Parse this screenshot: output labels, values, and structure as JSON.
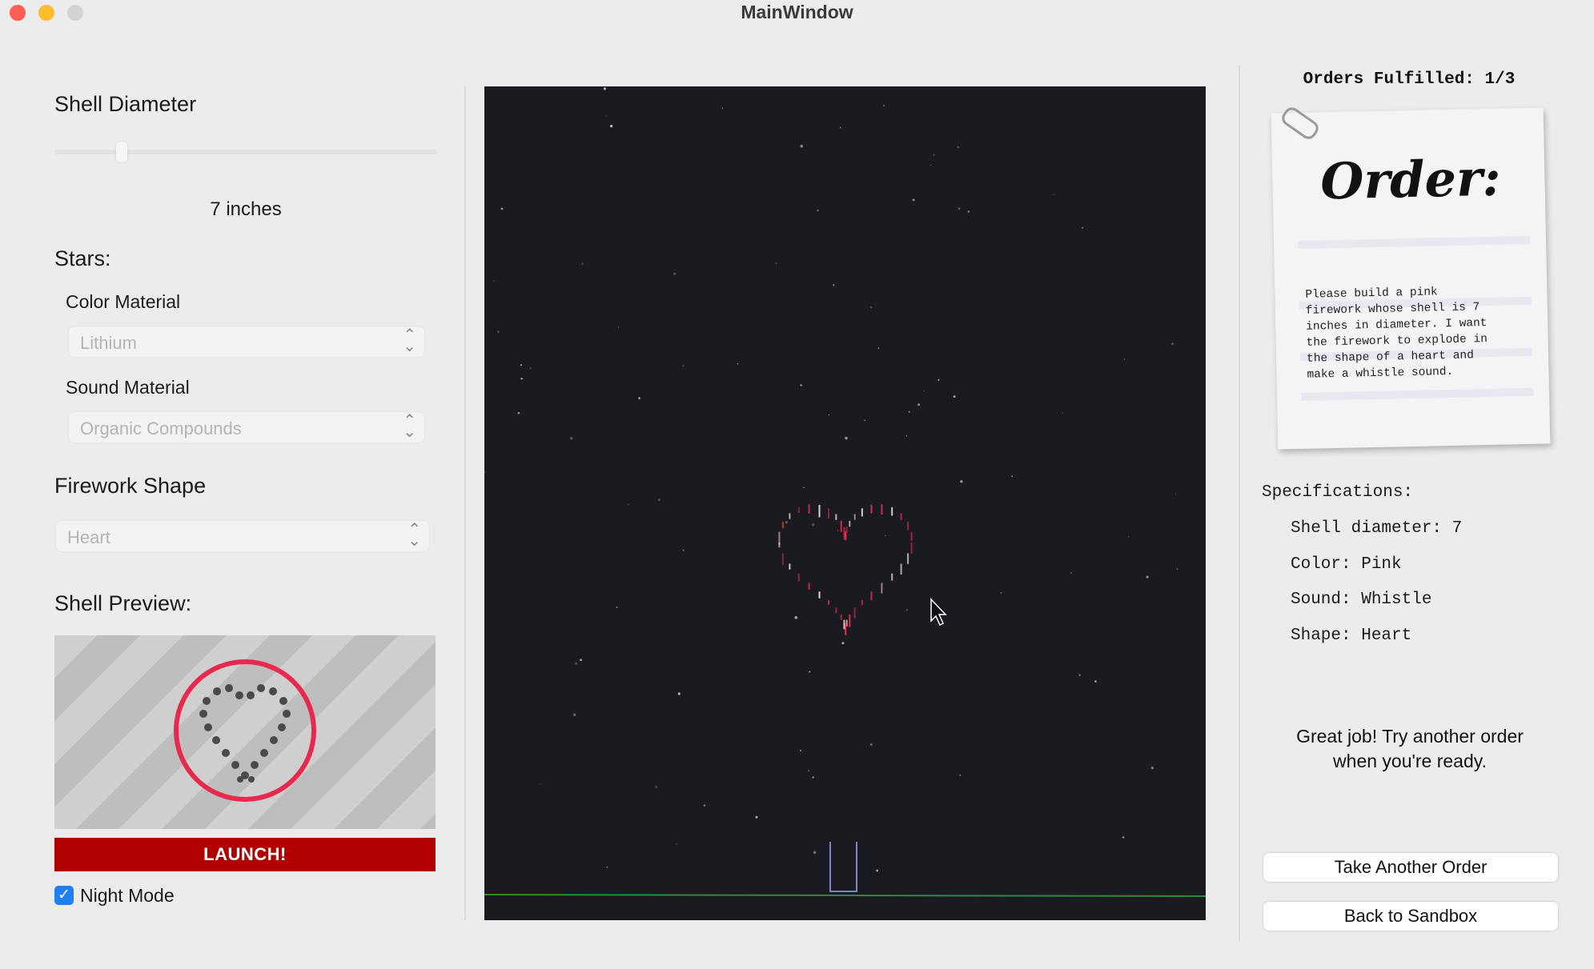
{
  "window": {
    "title": "MainWindow"
  },
  "left": {
    "shell_diameter": {
      "title": "Shell Diameter",
      "value_text": "7 inches",
      "level": 0.17
    },
    "stars": {
      "title": "Stars:",
      "color_material": {
        "label": "Color Material",
        "value": "Lithium"
      },
      "sound_material": {
        "label": "Sound Material",
        "value": "Organic Compounds"
      }
    },
    "firework_shape": {
      "title": "Firework Shape",
      "value": "Heart"
    },
    "shell_preview": {
      "title": "Shell Preview:",
      "ring_color": "#e8294e"
    },
    "launch_label": "LAUNCH!",
    "night_mode": {
      "label": "Night Mode",
      "checked": true
    }
  },
  "right": {
    "orders_fulfilled": "Orders Fulfilled: 1/3",
    "order_card": {
      "heading": "Order:",
      "lines": [
        "Please build a pink",
        "firework whose shell is 7",
        "inches in diameter. I want",
        "the firework to explode in",
        "the shape of a heart and",
        "make a whistle sound."
      ]
    },
    "specifications": {
      "title": "Specifications:",
      "lines": [
        "Shell diameter: 7",
        "Color: Pink",
        "Sound: Whistle",
        "Shape: Heart"
      ]
    },
    "message": [
      "Great job! Try another order",
      "when you're ready."
    ],
    "take_another_order": "Take Another Order",
    "back_to_sandbox": "Back to Sandbox"
  },
  "colors": {
    "launch": "#b10000",
    "firework": "#e8294e",
    "sky": "#1a1b21",
    "ground_line": "#2f8a3a",
    "launcher": "#7f82c8"
  }
}
